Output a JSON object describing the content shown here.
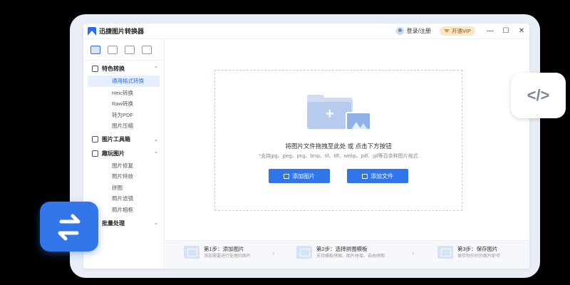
{
  "app": {
    "title": "迅捷图片转换器"
  },
  "header": {
    "login_label": "登录/注册",
    "vip_label": "开通VIP",
    "minimize": "—",
    "restore": "☐",
    "close": "✕"
  },
  "sidebar": {
    "groups": [
      {
        "label": "特色转换",
        "chevron": "⌃",
        "items": [
          "通用格式转换",
          "Heic转换",
          "Raw转换",
          "转为PDF",
          "图片压缩"
        ]
      },
      {
        "label": "图片工具箱",
        "chevron": "⌄",
        "items": []
      },
      {
        "label": "趣玩图片",
        "chevron": "⌃",
        "items": [
          "图片修复",
          "照片特效",
          "拼图",
          "照片滤镜",
          "照片相框"
        ]
      },
      {
        "label": "批量处理",
        "chevron": "⌄",
        "items": []
      }
    ]
  },
  "main": {
    "drop_title": "将图片文件拖拽至此处 或 点击下方按钮",
    "drop_hint": "*支持jpg、jpeg、png、bmp、tif、tiff、webp、pdf、gif等百余种图片格式",
    "add_image_label": "添加图片",
    "add_file_label": "添加文件"
  },
  "steps": [
    {
      "title": "第1步：添加图片",
      "desc": "添加需要进行处理的图片"
    },
    {
      "title": "第2步：选择拼图模板",
      "desc": "支持横板拼图、图片拼接、自由拼图"
    },
    {
      "title": "第3步：保存图片",
      "desc": "保存制作好的图片即可"
    }
  ],
  "badges": {
    "code_label": "</>"
  },
  "colors": {
    "accent": "#3175ea",
    "vip_bg": "#fbe6c6",
    "vip_text": "#8a5a1b"
  }
}
